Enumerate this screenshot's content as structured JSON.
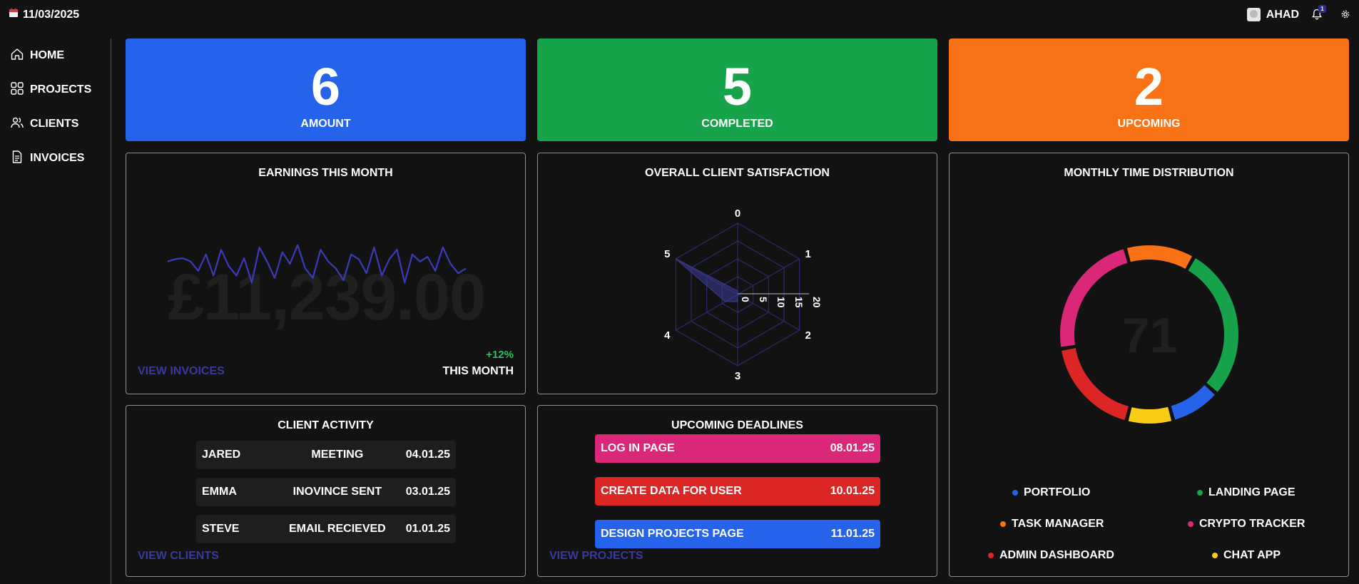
{
  "header": {
    "date": "11/03/2025",
    "user_name": "AHAD",
    "notification_count": "1"
  },
  "sidebar": {
    "items": [
      {
        "label": "HOME",
        "icon": "home-icon"
      },
      {
        "label": "PROJECTS",
        "icon": "grid-icon"
      },
      {
        "label": "CLIENTS",
        "icon": "users-icon"
      },
      {
        "label": "INVOICES",
        "icon": "document-icon"
      }
    ]
  },
  "stats": [
    {
      "value": "6",
      "label": "AMOUNT",
      "color": "#2563eb"
    },
    {
      "value": "5",
      "label": "COMPLETED",
      "color": "#16a34a"
    },
    {
      "value": "2",
      "label": "UPCOMING",
      "color": "#f97316"
    }
  ],
  "earnings": {
    "title": "EARNINGS THIS MONTH",
    "amount": "£11,239.00",
    "change": "+12%",
    "period": "THIS MONTH",
    "link": "VIEW INVOICES",
    "sparkline": [
      0.55,
      0.6,
      0.62,
      0.55,
      0.35,
      0.7,
      0.25,
      0.8,
      0.45,
      0.25,
      0.62,
      0.1,
      0.85,
      0.55,
      0.2,
      0.75,
      0.5,
      0.9,
      0.4,
      0.2,
      0.8,
      0.55,
      0.4,
      0.15,
      0.7,
      0.6,
      0.3,
      0.85,
      0.25,
      0.6,
      0.8,
      0.1,
      0.7,
      0.55,
      0.65,
      0.35,
      0.85,
      0.5,
      0.3,
      0.4
    ]
  },
  "satisfaction": {
    "title": "OVERALL CLIENT SATISFACTION",
    "chart_data": {
      "type": "radar",
      "categories": [
        "0",
        "1",
        "2",
        "3",
        "4",
        "5"
      ],
      "values": [
        1,
        0,
        0,
        2,
        4,
        20
      ],
      "rlim": [
        0,
        20
      ],
      "r_ticks": [
        "0",
        "5",
        "10",
        "15",
        "20"
      ]
    }
  },
  "time_distribution": {
    "title": "MONTHLY TIME DISTRIBUTION",
    "center_value": "71",
    "chart_data": {
      "type": "pie",
      "categories": [
        "PORTFOLIO",
        "LANDING PAGE",
        "TASK MANAGER",
        "CRYPTO TRACKER",
        "ADMIN DASHBOARD",
        "CHAT APP"
      ],
      "values": [
        6.5,
        20,
        9,
        16.5,
        13,
        6
      ],
      "order": [
        "LANDING PAGE",
        "PORTFOLIO",
        "CHAT APP",
        "ADMIN DASHBOARD",
        "CRYPTO TRACKER",
        "TASK MANAGER"
      ],
      "colors": {
        "PORTFOLIO": "#2563eb",
        "LANDING PAGE": "#16a34a",
        "TASK MANAGER": "#f97316",
        "CRYPTO TRACKER": "#db2777",
        "ADMIN DASHBOARD": "#dc2626",
        "CHAT APP": "#facc15"
      }
    },
    "legend": [
      {
        "label": "PORTFOLIO",
        "color": "#2563eb"
      },
      {
        "label": "LANDING PAGE",
        "color": "#16a34a"
      },
      {
        "label": "TASK MANAGER",
        "color": "#f97316"
      },
      {
        "label": "CRYPTO TRACKER",
        "color": "#db2777"
      },
      {
        "label": "ADMIN DASHBOARD",
        "color": "#dc2626"
      },
      {
        "label": "CHAT APP",
        "color": "#facc15"
      }
    ]
  },
  "client_activity": {
    "title": "CLIENT ACTIVITY",
    "rows": [
      {
        "name": "JARED",
        "activity": "MEETING",
        "date": "04.01.25"
      },
      {
        "name": "EMMA",
        "activity": "INOVINCE SENT",
        "date": "03.01.25"
      },
      {
        "name": "STEVE",
        "activity": "EMAIL RECIEVED",
        "date": "01.01.25"
      }
    ],
    "link": "VIEW CLIENTS"
  },
  "deadlines": {
    "title": "UPCOMING DEADLINES",
    "rows": [
      {
        "task": "LOG IN PAGE",
        "date": "08.01.25",
        "color": "#db2777"
      },
      {
        "task": "CREATE DATA FOR USER",
        "date": "10.01.25",
        "color": "#dc2626"
      },
      {
        "task": "DESIGN PROJECTS PAGE",
        "date": "11.01.25",
        "color": "#2563eb"
      }
    ],
    "link": "VIEW PROJECTS"
  }
}
